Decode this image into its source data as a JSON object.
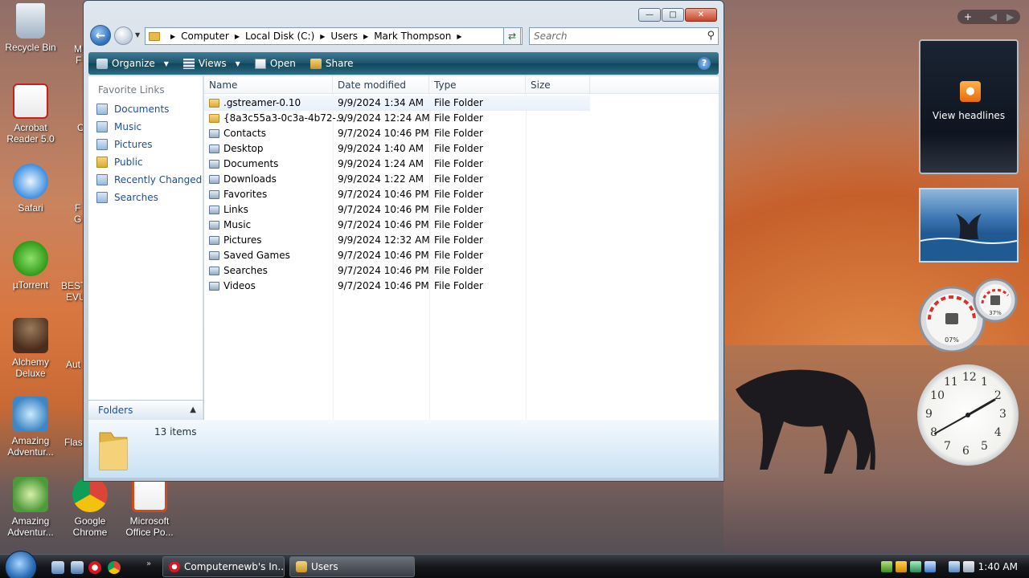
{
  "desktop": {
    "icons": [
      {
        "label": "Recycle Bin",
        "icon": "recycle-bin-icon"
      },
      {
        "label": "Acrobat Reader 5.0",
        "icon": "acrobat-icon"
      },
      {
        "label": "Safari",
        "icon": "safari-icon"
      },
      {
        "label": "µTorrent",
        "icon": "utorrent-icon"
      },
      {
        "label": "Alchemy Deluxe",
        "icon": "alchemy-icon"
      },
      {
        "label": "Amazing Adventur...",
        "icon": "amazing-adventures-icon"
      },
      {
        "label": "Amazing Adventur...",
        "icon": "amazing-adventures-icon"
      },
      {
        "label": "Google Chrome",
        "icon": "chrome-icon"
      },
      {
        "label": "Microsoft Office Po...",
        "icon": "office-icon"
      }
    ],
    "partial_labels": [
      "M",
      "F",
      "C",
      "F",
      "G",
      "BEST",
      "EVU",
      "Aut",
      "Flas"
    ]
  },
  "window": {
    "address": {
      "crumbs": [
        "Computer",
        "Local Disk (C:)",
        "Users",
        "Mark Thompson"
      ]
    },
    "search_placeholder": "Search",
    "toolbar": {
      "organize": "Organize",
      "views": "Views",
      "open": "Open",
      "share": "Share"
    },
    "nav_pane": {
      "title": "Favorite Links",
      "links": [
        "Documents",
        "Music",
        "Pictures",
        "Public",
        "Recently Changed",
        "Searches"
      ],
      "folders_label": "Folders"
    },
    "columns": [
      "Name",
      "Date modified",
      "Type",
      "Size"
    ],
    "files": [
      {
        "name": ".gstreamer-0.10",
        "date": "9/9/2024 1:34 AM",
        "type": "File Folder",
        "special": false
      },
      {
        "name": "{8a3c55a3-0c3a-4b72-...",
        "date": "9/9/2024 12:24 AM",
        "type": "File Folder",
        "special": false
      },
      {
        "name": "Contacts",
        "date": "9/7/2024 10:46 PM",
        "type": "File Folder",
        "special": true
      },
      {
        "name": "Desktop",
        "date": "9/9/2024 1:40 AM",
        "type": "File Folder",
        "special": true
      },
      {
        "name": "Documents",
        "date": "9/9/2024 1:24 AM",
        "type": "File Folder",
        "special": true
      },
      {
        "name": "Downloads",
        "date": "9/9/2024 1:22 AM",
        "type": "File Folder",
        "special": true
      },
      {
        "name": "Favorites",
        "date": "9/7/2024 10:46 PM",
        "type": "File Folder",
        "special": true
      },
      {
        "name": "Links",
        "date": "9/7/2024 10:46 PM",
        "type": "File Folder",
        "special": true
      },
      {
        "name": "Music",
        "date": "9/7/2024 10:46 PM",
        "type": "File Folder",
        "special": true
      },
      {
        "name": "Pictures",
        "date": "9/9/2024 12:32 AM",
        "type": "File Folder",
        "special": true
      },
      {
        "name": "Saved Games",
        "date": "9/7/2024 10:46 PM",
        "type": "File Folder",
        "special": true
      },
      {
        "name": "Searches",
        "date": "9/7/2024 10:46 PM",
        "type": "File Folder",
        "special": true
      },
      {
        "name": "Videos",
        "date": "9/7/2024 10:46 PM",
        "type": "File Folder",
        "special": true
      }
    ],
    "details": {
      "count": "13 items"
    }
  },
  "sidebar": {
    "feed_label": "View headlines",
    "cpu_percent": "07%",
    "mem_percent": "37%",
    "clock_numbers": [
      "12",
      "1",
      "2",
      "3",
      "4",
      "5",
      "6",
      "7",
      "8",
      "9",
      "10",
      "11"
    ]
  },
  "taskbar": {
    "tasks": [
      {
        "label": "Computernewb's In...",
        "icon": "opera-icon"
      },
      {
        "label": "Users",
        "icon": "folder-icon"
      }
    ],
    "time": "1:40 AM"
  },
  "colors": {
    "accent": "#1e5369",
    "link": "#1a4fa0",
    "taskbar": "#15171b"
  }
}
